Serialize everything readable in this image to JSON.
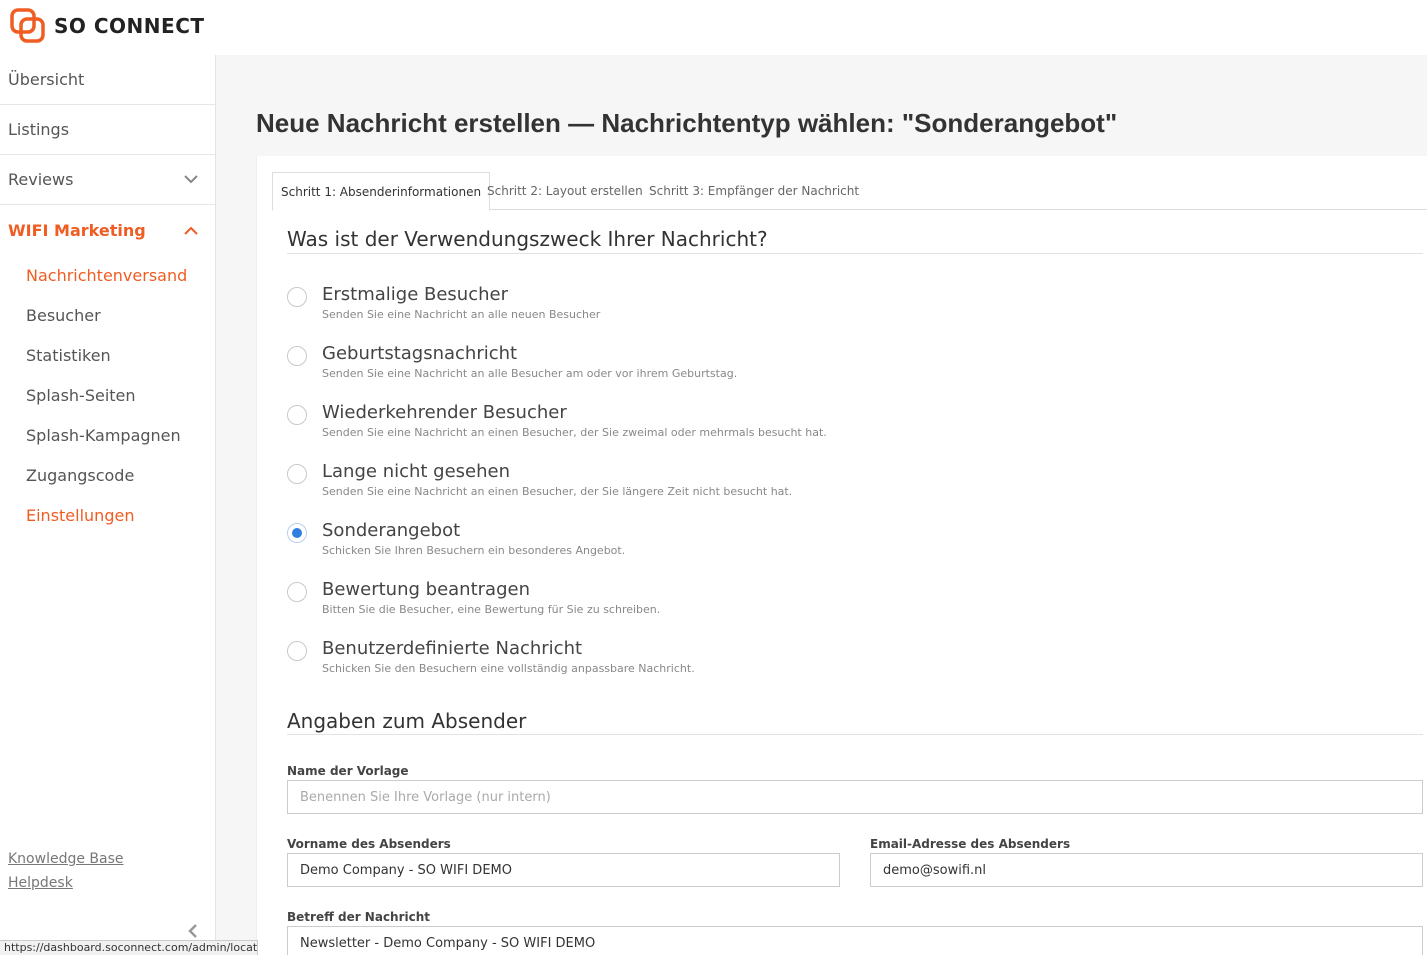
{
  "brand": {
    "name": "SO CONNECT",
    "accent": "#f05d23"
  },
  "sidebar": {
    "items": [
      {
        "label": "Übersicht"
      },
      {
        "label": "Listings"
      },
      {
        "label": "Reviews",
        "icon": "chevron-down-icon"
      },
      {
        "label": "WIFI Marketing",
        "icon": "chevron-up-icon",
        "active": true
      }
    ],
    "sub_items": [
      {
        "label": "Nachrichtenversand",
        "highlighted": true
      },
      {
        "label": "Besucher"
      },
      {
        "label": "Statistiken"
      },
      {
        "label": "Splash-Seiten"
      },
      {
        "label": "Splash-Kampagnen"
      },
      {
        "label": "Zugangscode"
      },
      {
        "label": "Einstellungen",
        "highlighted": true
      }
    ],
    "links": {
      "knowledge_base": "Knowledge Base",
      "helpdesk": "Helpdesk"
    }
  },
  "status_url": "https://dashboard.soconnect.com/admin/locations",
  "page": {
    "title": "Neue Nachricht erstellen — Nachrichtentyp wählen: \"Sonderangebot\""
  },
  "tabs": [
    {
      "label": "Schritt 1: Absenderinformationen",
      "active": true
    },
    {
      "label": "Schritt 2: Layout erstellen"
    },
    {
      "label": "Schritt 3: Empfänger der Nachricht"
    }
  ],
  "purpose": {
    "title": "Was ist der Verwendungszweck Ihrer Nachricht?",
    "options": [
      {
        "label": "Erstmalige Besucher",
        "desc": "Senden Sie eine Nachricht an alle neuen Besucher",
        "checked": false
      },
      {
        "label": "Geburtstagsnachricht",
        "desc": "Senden Sie eine Nachricht an alle Besucher am oder vor ihrem Geburtstag.",
        "checked": false
      },
      {
        "label": "Wiederkehrender Besucher",
        "desc": "Senden Sie eine Nachricht an einen Besucher, der Sie zweimal oder mehrmals besucht hat.",
        "checked": false
      },
      {
        "label": "Lange nicht gesehen",
        "desc": "Senden Sie eine Nachricht an einen Besucher, der Sie längere Zeit nicht besucht hat.",
        "checked": false
      },
      {
        "label": "Sonderangebot",
        "desc": "Schicken Sie Ihren Besuchern ein besonderes Angebot.",
        "checked": true
      },
      {
        "label": "Bewertung beantragen",
        "desc": "Bitten Sie die Besucher, eine Bewertung für Sie zu schreiben.",
        "checked": false
      },
      {
        "label": "Benutzerdefinierte Nachricht",
        "desc": "Schicken Sie den Besuchern eine vollständig anpassbare Nachricht.",
        "checked": false
      }
    ]
  },
  "sender": {
    "title": "Angaben zum Absender",
    "template_name": {
      "label": "Name der Vorlage",
      "placeholder": "Benennen Sie Ihre Vorlage (nur intern)",
      "value": ""
    },
    "first_name": {
      "label": "Vorname des Absenders",
      "value": "Demo Company - SO WIFI DEMO"
    },
    "email": {
      "label": "Email-Adresse des Absenders",
      "value": "demo@sowifi.nl"
    },
    "subject": {
      "label": "Betreff der Nachricht",
      "value": "Newsletter - Demo Company - SO WIFI DEMO"
    }
  }
}
